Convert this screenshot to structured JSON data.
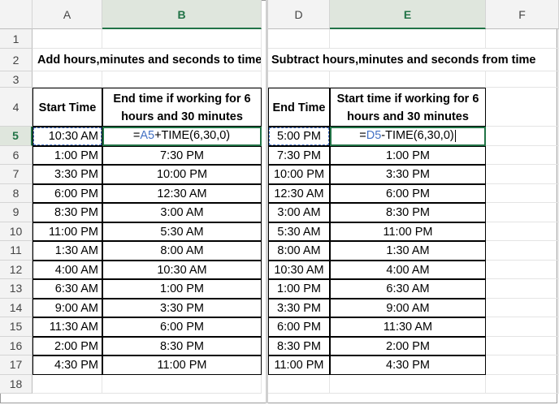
{
  "left": {
    "column_headers": [
      "A",
      "B"
    ],
    "title": "Add hours,minutes and seconds to time",
    "table_headers": [
      "Start Time",
      "End time if working for 6 hours and 30 minutes"
    ],
    "formula_ref": "A5",
    "formula": "=A5+TIME(6,30,0)",
    "start_times": [
      "10:30 AM",
      "1:00 PM",
      "3:30 PM",
      "6:00 PM",
      "8:30 PM",
      "11:00 PM",
      "1:30 AM",
      "4:00 AM",
      "6:30 AM",
      "9:00 AM",
      "11:30 AM",
      "2:00 PM",
      "4:30 PM"
    ],
    "end_times": [
      "",
      "7:30 PM",
      "10:00 PM",
      "12:30 AM",
      "3:00 AM",
      "5:30 AM",
      "8:00 AM",
      "10:30 AM",
      "1:00 PM",
      "3:30 PM",
      "6:00 PM",
      "8:30 PM",
      "11:00 PM"
    ]
  },
  "right": {
    "column_headers": [
      "D",
      "E",
      "F"
    ],
    "title": "Subtract hours,minutes and seconds from time",
    "table_headers": [
      "End Time",
      "Start time if working for 6 hours and 30 minutes"
    ],
    "formula_ref": "D5",
    "formula": "=D5-TIME(6,30,0)",
    "end_times": [
      "5:00 PM",
      "7:30 PM",
      "10:00 PM",
      "12:30 AM",
      "3:00 AM",
      "5:30 AM",
      "8:00 AM",
      "10:30 AM",
      "1:00 PM",
      "3:30 PM",
      "6:00 PM",
      "8:30 PM",
      "11:00 PM"
    ],
    "start_times": [
      "",
      "1:00 PM",
      "3:30 PM",
      "6:00 PM",
      "8:30 PM",
      "11:00 PM",
      "1:30 AM",
      "4:00 AM",
      "6:30 AM",
      "9:00 AM",
      "11:30 AM",
      "2:00 PM",
      "4:30 PM"
    ]
  },
  "row_numbers": [
    "1",
    "2",
    "3",
    "4",
    "5",
    "6",
    "7",
    "8",
    "9",
    "10",
    "11",
    "12",
    "13",
    "14",
    "15",
    "16",
    "17",
    "18"
  ],
  "active_row": "5",
  "selected_columns": [
    "B",
    "E"
  ]
}
